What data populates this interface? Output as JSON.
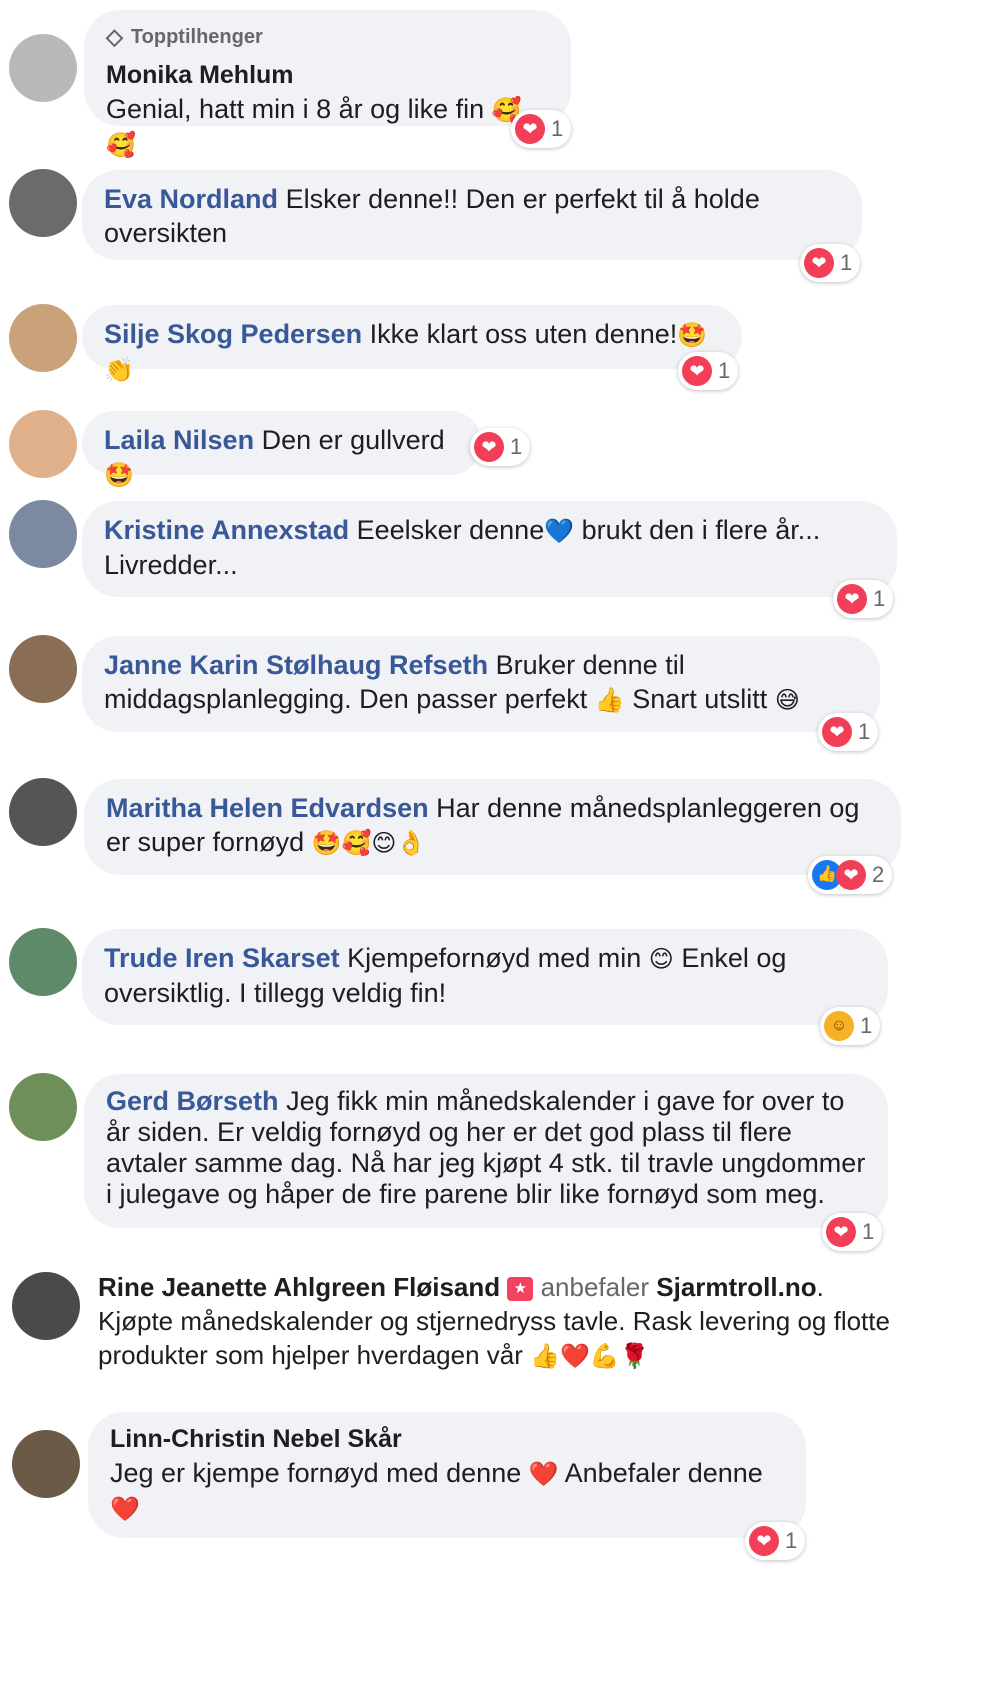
{
  "comments": [
    {
      "badge": "Topptilhenger",
      "name": "Monika Mehlum",
      "text": "Genial, hatt min i 8 år og like fin",
      "emoji": "🥰🥰",
      "reaction_count": "1",
      "avatar_color": "#b9b9b9"
    },
    {
      "name": "Eva Nordland",
      "text": "Elsker denne!! Den er perfekt til å holde oversikten",
      "reaction_count": "1",
      "avatar_color": "#6b6b6b"
    },
    {
      "name": "Silje Skog Pedersen",
      "text": "Ikke klart oss uten denne!",
      "emoji": "🤩👏",
      "reaction_count": "1",
      "avatar_color": "#c9a27a"
    },
    {
      "name": "Laila Nilsen",
      "text": "Den er gullverd",
      "emoji": "🤩",
      "reaction_count": "1",
      "avatar_color": "#e0b08a"
    },
    {
      "name": "Kristine Annexstad",
      "text": "Eeelsker denne",
      "emoji": "💙",
      "text2": "brukt den i flere år... Livredder...",
      "reaction_count": "1",
      "avatar_color": "#7b8aa0"
    },
    {
      "name": "Janne Karin Stølhaug Refseth",
      "text": "Bruker denne til middagsplanlegging. Den passer perfekt",
      "emoji": "👍",
      "text2": "Snart utslitt",
      "emoji2": "😅",
      "reaction_count": "1",
      "avatar_color": "#8a6d55"
    },
    {
      "name": "Maritha Helen Edvardsen",
      "text": "Har denne månedsplanleggeren og er super fornøyd",
      "emoji": "🤩🥰😊👌",
      "reaction_count": "2",
      "avatar_color": "#555555"
    },
    {
      "name": "Trude Iren Skarset",
      "text": "Kjempefornøyd med min",
      "emoji": "😊",
      "text2": "Enkel og oversiktlig. I tillegg veldig fin!",
      "reaction_count": "1",
      "avatar_color": "#5f8a6a"
    },
    {
      "name": "Gerd Børseth",
      "text": "Jeg fikk min månedskalender i gave for over to år siden. Er veldig fornøyd og her er det god plass til flere avtaler samme dag. Nå har jeg kjøpt 4 stk. til travle ungdommer i julegave og håper de fire parene blir like fornøyd som meg.",
      "reaction_count": "1",
      "avatar_color": "#6f8f5a"
    },
    {
      "name": "Linn-Christin Nebel Skår",
      "text": "Jeg er kjempe fornøyd med denne",
      "emoji": "❤️",
      "text2": "Anbefaler denne",
      "emoji2": "❤️",
      "reaction_count": "1",
      "avatar_color": "#6b5a45"
    }
  ],
  "recommendation": {
    "name": "Rine Jeanette Ahlgreen Fløisand",
    "verb": "anbefaler",
    "page": "Sjarmtroll.no",
    "period": ".",
    "text": "Kjøpte månedskalender og stjernedryss tavle. Rask levering og flotte produkter som hjelper hverdagen vår",
    "emoji": "👍❤️💪🌹",
    "avatar_color": "#4a4a4a"
  },
  "icons": {
    "heart": "❤",
    "like": "👍",
    "star": "★",
    "diamond": "◇"
  }
}
